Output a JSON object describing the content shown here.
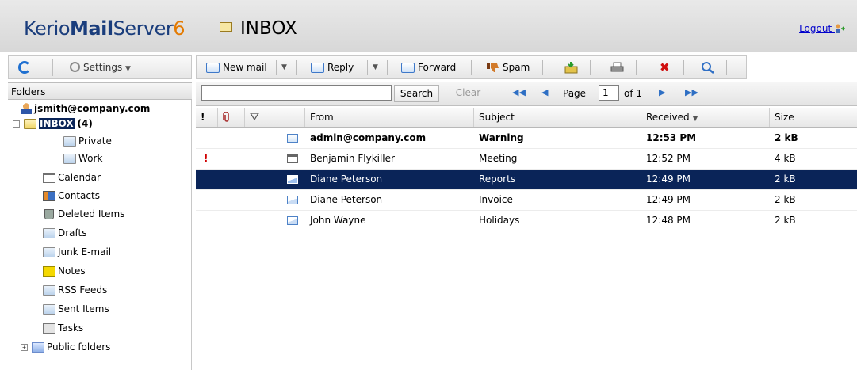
{
  "header": {
    "brand_prefix": "Kerio",
    "brand_mail": "Mail",
    "brand_server": "Server",
    "brand_version": "6",
    "folder_title": "INBOX",
    "logout_label": "Logout"
  },
  "left_toolbar": {
    "refresh_icon": "refresh-icon",
    "settings_label": "Settings"
  },
  "folders": {
    "header": "Folders",
    "account": "jsmith@company.com",
    "inbox_label": "INBOX",
    "inbox_count": "(4)",
    "items": [
      {
        "label": "Private",
        "icon": "folder-icon"
      },
      {
        "label": "Work",
        "icon": "folder-icon"
      },
      {
        "label": "Calendar",
        "icon": "calendar-icon"
      },
      {
        "label": "Contacts",
        "icon": "contacts-icon"
      },
      {
        "label": "Deleted Items",
        "icon": "trash-icon"
      },
      {
        "label": "Drafts",
        "icon": "folder-icon"
      },
      {
        "label": "Junk E-mail",
        "icon": "folder-icon"
      },
      {
        "label": "Notes",
        "icon": "notes-icon"
      },
      {
        "label": "RSS Feeds",
        "icon": "folder-icon"
      },
      {
        "label": "Sent Items",
        "icon": "folder-icon"
      },
      {
        "label": "Tasks",
        "icon": "tasks-icon"
      },
      {
        "label": "Public folders",
        "icon": "public-folder-icon"
      }
    ]
  },
  "toolbar": {
    "new_mail": "New mail",
    "reply": "Reply",
    "forward": "Forward",
    "spam": "Spam"
  },
  "search": {
    "value": "",
    "search_label": "Search",
    "clear_label": "Clear",
    "page_label": "Page",
    "page_value": "1",
    "of_label": "of 1"
  },
  "grid": {
    "columns": {
      "priority": "!",
      "attachment": "attachment-icon",
      "flag": "flag-icon",
      "from": "From",
      "subject": "Subject",
      "received": "Received",
      "size": "Size"
    },
    "rows": [
      {
        "from": "admin@company.com",
        "subject": "Warning",
        "received": "12:53 PM",
        "size": "2 kB",
        "unread": true,
        "priority": "",
        "icon": "mail-unread-icon"
      },
      {
        "from": "Benjamin Flykiller",
        "subject": "Meeting",
        "received": "12:52 PM",
        "size": "4 kB",
        "unread": false,
        "priority": "!",
        "icon": "meeting-request-icon"
      },
      {
        "from": "Diane Peterson",
        "subject": "Reports",
        "received": "12:49 PM",
        "size": "2 kB",
        "unread": false,
        "priority": "",
        "icon": "mail-read-icon",
        "selected": true
      },
      {
        "from": "Diane Peterson",
        "subject": "Invoice",
        "received": "12:49 PM",
        "size": "2 kB",
        "unread": false,
        "priority": "",
        "icon": "mail-read-icon"
      },
      {
        "from": "John Wayne",
        "subject": "Holidays",
        "received": "12:48 PM",
        "size": "2 kB",
        "unread": false,
        "priority": "",
        "icon": "mail-read-icon"
      }
    ]
  },
  "colors": {
    "selection": "#0a2458",
    "brand_blue": "#1a3d7c",
    "brand_orange": "#e47a00",
    "priority_red": "#d00000"
  }
}
